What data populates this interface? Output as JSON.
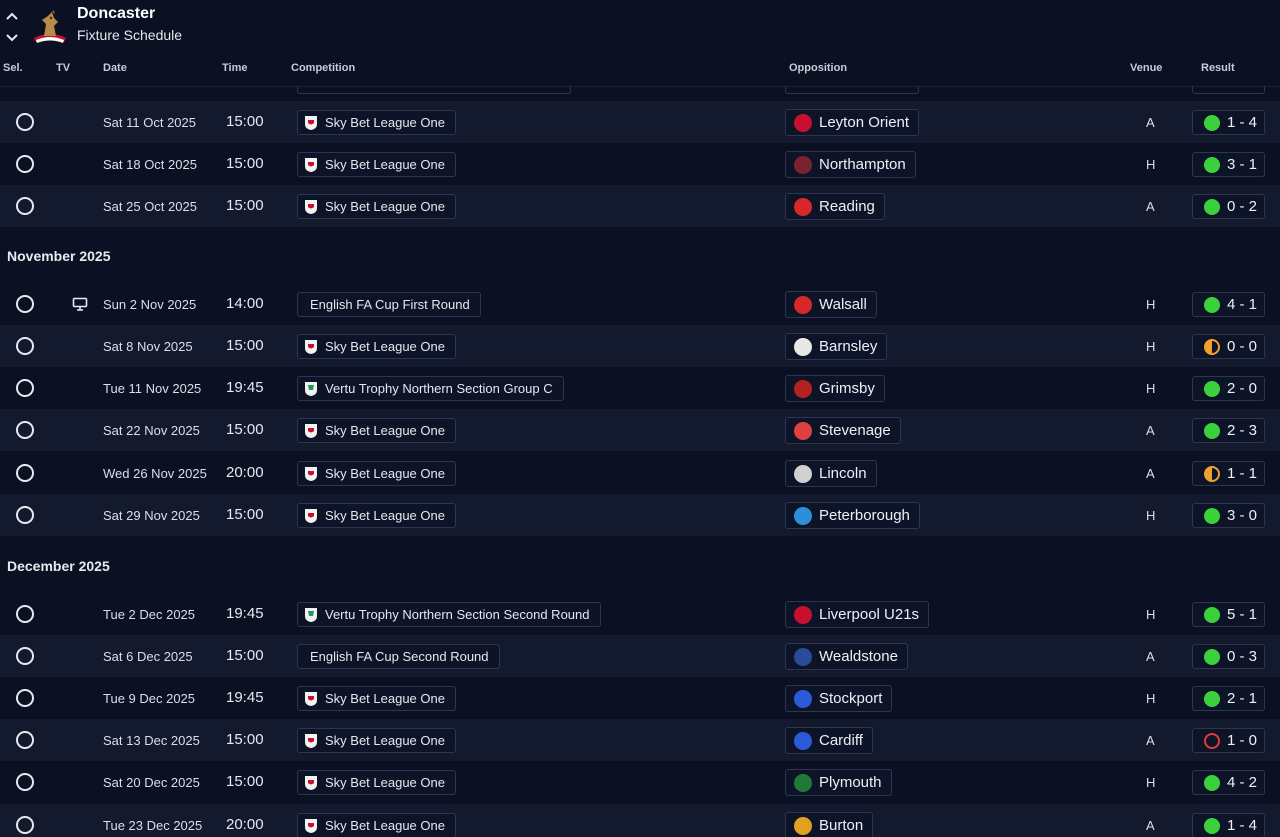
{
  "header": {
    "team": "Doncaster",
    "subtitle": "Fixture Schedule"
  },
  "columns": {
    "sel": "Sel.",
    "tv": "TV",
    "date": "Date",
    "time": "Time",
    "competition": "Competition",
    "opposition": "Opposition",
    "venue": "Venue",
    "result": "Result"
  },
  "months": {
    "nov": "November 2025",
    "dec": "December 2025"
  },
  "fixtures": [
    {
      "date": "Sat 11 Oct 2025",
      "time": "15:00",
      "comp": "Sky Bet League One",
      "opp": "Leyton Orient",
      "venue": "A",
      "result": "1 - 4",
      "outcome": "win",
      "opp_color": "#c8102e"
    },
    {
      "date": "Sat 18 Oct 2025",
      "time": "15:00",
      "comp": "Sky Bet League One",
      "opp": "Northampton",
      "venue": "H",
      "result": "3 - 1",
      "outcome": "win",
      "opp_color": "#7a2230"
    },
    {
      "date": "Sat 25 Oct 2025",
      "time": "15:00",
      "comp": "Sky Bet League One",
      "opp": "Reading",
      "venue": "A",
      "result": "0 - 2",
      "outcome": "win",
      "opp_color": "#d62828"
    },
    {
      "date": "Sun 2 Nov 2025",
      "time": "14:00",
      "comp": "English FA Cup First Round",
      "opp": "Walsall",
      "venue": "H",
      "result": "4 - 1",
      "outcome": "win",
      "opp_color": "#d62828",
      "tv": true
    },
    {
      "date": "Sat 8 Nov 2025",
      "time": "15:00",
      "comp": "Sky Bet League One",
      "opp": "Barnsley",
      "venue": "H",
      "result": "0 - 0",
      "outcome": "draw",
      "opp_color": "#e8e8e8"
    },
    {
      "date": "Tue 11 Nov 2025",
      "time": "19:45",
      "comp": "Vertu Trophy Northern Section Group C",
      "opp": "Grimsby",
      "venue": "H",
      "result": "2 - 0",
      "outcome": "win",
      "opp_color": "#b22222"
    },
    {
      "date": "Sat 22 Nov 2025",
      "time": "15:00",
      "comp": "Sky Bet League One",
      "opp": "Stevenage",
      "venue": "A",
      "result": "2 - 3",
      "outcome": "win",
      "opp_color": "#e04040"
    },
    {
      "date": "Wed 26 Nov 2025",
      "time": "20:00",
      "comp": "Sky Bet League One",
      "opp": "Lincoln",
      "venue": "A",
      "result": "1 - 1",
      "outcome": "draw",
      "opp_color": "#d0d0d0"
    },
    {
      "date": "Sat 29 Nov 2025",
      "time": "15:00",
      "comp": "Sky Bet League One",
      "opp": "Peterborough",
      "venue": "H",
      "result": "3 - 0",
      "outcome": "win",
      "opp_color": "#2a8fd8"
    },
    {
      "date": "Tue 2 Dec 2025",
      "time": "19:45",
      "comp": "Vertu Trophy Northern Section Second Round",
      "opp": "Liverpool U21s",
      "venue": "H",
      "result": "5 - 1",
      "outcome": "win",
      "opp_color": "#c8102e"
    },
    {
      "date": "Sat 6 Dec 2025",
      "time": "15:00",
      "comp": "English FA Cup Second Round",
      "opp": "Wealdstone",
      "venue": "A",
      "result": "0 - 3",
      "outcome": "win",
      "opp_color": "#2a4a9a"
    },
    {
      "date": "Tue 9 Dec 2025",
      "time": "19:45",
      "comp": "Sky Bet League One",
      "opp": "Stockport",
      "venue": "H",
      "result": "2 - 1",
      "outcome": "win",
      "opp_color": "#2a5ad8"
    },
    {
      "date": "Sat 13 Dec 2025",
      "time": "15:00",
      "comp": "Sky Bet League One",
      "opp": "Cardiff",
      "venue": "A",
      "result": "1 - 0",
      "outcome": "loss",
      "opp_color": "#2a5ad8"
    },
    {
      "date": "Sat 20 Dec 2025",
      "time": "15:00",
      "comp": "Sky Bet League One",
      "opp": "Plymouth",
      "venue": "H",
      "result": "4 - 2",
      "outcome": "win",
      "opp_color": "#1f7a3a"
    },
    {
      "date": "Tue 23 Dec 2025",
      "time": "20:00",
      "comp": "Sky Bet League One",
      "opp": "Burton",
      "venue": "A",
      "result": "1 - 4",
      "outcome": "win",
      "opp_color": "#e0a020"
    }
  ]
}
